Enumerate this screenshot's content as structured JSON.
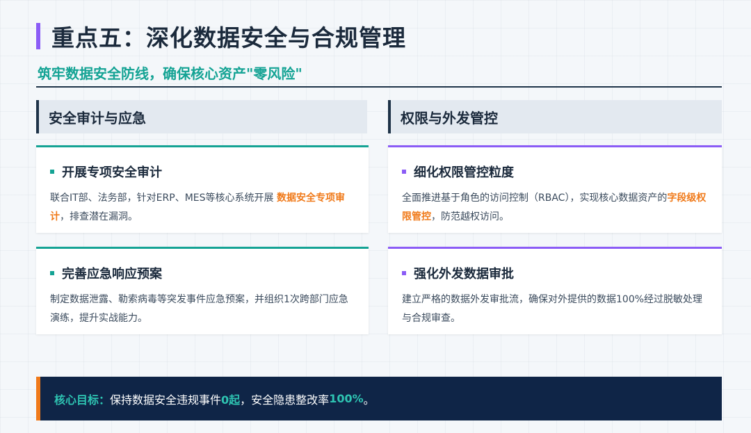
{
  "header": {
    "title": "重点五：深化数据安全与合规管理",
    "subtitle": "筑牢数据安全防线，确保核心资产\"零风险\""
  },
  "left": {
    "heading": "安全审计与应急",
    "cards": [
      {
        "title": "开展专项安全审计",
        "body_pre": "联合IT部、法务部，针对ERP、MES等核心系统开展 ",
        "body_hl": "数据安全专项审计",
        "body_post": "，排查潜在漏洞。"
      },
      {
        "title": "完善应急响应预案",
        "body": "制定数据泄露、勒索病毒等突发事件应急预案，并组织1次跨部门应急演练，提升实战能力。"
      }
    ]
  },
  "right": {
    "heading": "权限与外发管控",
    "cards": [
      {
        "title": "细化权限管控粒度",
        "body_pre": "全面推进基于角色的访问控制（RBAC），实现核心数据资产的",
        "body_hl": "字段级权限管控",
        "body_post": "，防范越权访问。"
      },
      {
        "title": "强化外发数据审批",
        "body": "建立严格的数据外发审批流，确保对外提供的数据100%经过脱敏处理与合规审查。"
      }
    ]
  },
  "goal": {
    "label": "核心目标：",
    "text1": "保持数据安全违规事件 ",
    "value1": "0起",
    "text2": "，安全隐患整改率 ",
    "value2": "100%",
    "text3": "。"
  },
  "colors": {
    "teal": "#14a394",
    "purple": "#8b5cf6",
    "orange": "#f07a1a",
    "navy": "#0f2547"
  }
}
